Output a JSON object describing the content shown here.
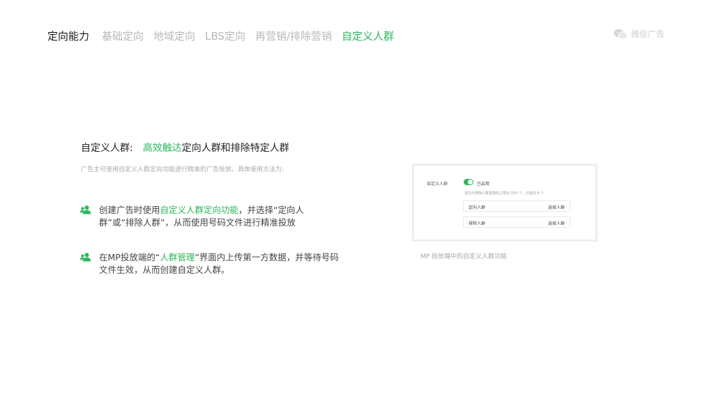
{
  "nav": {
    "title": "定向能力",
    "items": [
      {
        "label": "基础定向"
      },
      {
        "label": "地域定向"
      },
      {
        "label": "LBS定向"
      },
      {
        "label": "再营销/排除营销"
      },
      {
        "label": "自定义人群"
      }
    ],
    "active_index": 4
  },
  "brand": {
    "label": "微信广告",
    "icon": "wechat-icon"
  },
  "section": {
    "heading_prefix": "自定义人群:",
    "heading_highlight": "高效触达",
    "heading_rest": "定向人群和排除特定人群",
    "subtitle": "广告主可使用自定义人群定向功能进行精准的广告投放。具体使用方法为:"
  },
  "bullets": [
    {
      "icon": "user-group-icon",
      "before": "创建广告时使用",
      "highlight": "自定义人群定向功能",
      "after": "，并选择“定向人群”或“排除人群”，从而使用号码文件进行精准投放"
    },
    {
      "icon": "user-group-icon",
      "before": "在MP投放端的“",
      "highlight": "人群管理",
      "after": "”界面内上传第一方数据，并等待号码文件生效，从而创建自定义人群。"
    }
  ],
  "card": {
    "label": "自定义人群",
    "toggle_on": true,
    "status": "已启用",
    "hint_before": "定向与排除人群选择的上限为 200 个，已选共 ",
    "hint_count": "0",
    "hint_after": " 个",
    "rows": [
      {
        "label": "定向人群",
        "action": "选择人群"
      },
      {
        "label": "排除人群",
        "action": "选择人群"
      }
    ]
  },
  "caption": "MP 投放端中的自定义人群功能",
  "colors": {
    "accent": "#2bb75b",
    "muted": "#b8b8b8",
    "text": "#333333"
  }
}
